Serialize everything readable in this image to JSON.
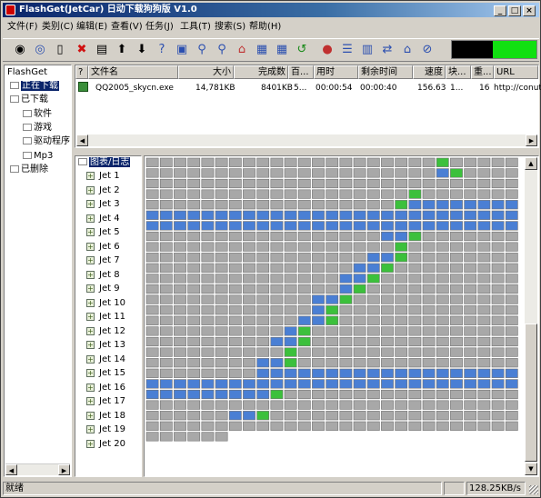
{
  "window": {
    "title": "FlashGet(JetCar) 日动下载狗狗版 V1.0"
  },
  "menu": [
    "文件(F)",
    "类别(C)",
    "编辑(E)",
    "查看(V)",
    "任务(J)",
    "工具(T)",
    "搜索(S)",
    "帮助(H)"
  ],
  "tree": {
    "root": "FlashGet",
    "downloading": "正在下载",
    "downloaded": "已下载",
    "categories": [
      "软件",
      "游戏",
      "驱动程序",
      "Mp3"
    ],
    "deleted": "已删除"
  },
  "list": {
    "columns": [
      "文件名",
      "大小",
      "完成数",
      "百...",
      "用时",
      "剩余时间",
      "速度",
      "块...",
      "重...",
      "URL"
    ],
    "rows": [
      {
        "name": "QQ2005_skycn.exe",
        "size": "14,781KB",
        "done": "8401KB",
        "percent": "5...",
        "elapsed": "00:00:54",
        "remaining": "00:00:40",
        "speed": "156.63",
        "blocks": "1...",
        "retries": "16",
        "url": "http://conut.s"
      }
    ]
  },
  "jets": {
    "header": "图表/日志",
    "items": [
      "Jet 1",
      "Jet 2",
      "Jet 3",
      "Jet 4",
      "Jet 5",
      "Jet 6",
      "Jet 7",
      "Jet 8",
      "Jet 9",
      "Jet 10",
      "Jet 11",
      "Jet 12",
      "Jet 13",
      "Jet 14",
      "Jet 15",
      "Jet 16",
      "Jet 17",
      "Jet 18",
      "Jet 19",
      "Jet 20"
    ]
  },
  "blockmap": {
    "colors": {
      "pending": "#a8a8a8",
      "done": "#4a7fd4",
      "active": "#3cc03c",
      "empty": "#ffffff"
    },
    "cols": 27,
    "rows": [
      {
        "done": [],
        "active": [
          21
        ]
      },
      {
        "done": [
          21
        ],
        "active": [
          22
        ]
      },
      {
        "done": [],
        "active": []
      },
      {
        "done": [],
        "active": [
          19
        ]
      },
      {
        "done": [
          19,
          20,
          21,
          22,
          23,
          24,
          25,
          26
        ],
        "active": [
          18
        ]
      },
      {
        "done": [
          0,
          1,
          2,
          3,
          4,
          5,
          6,
          7,
          8,
          9,
          10,
          11,
          12,
          13,
          14,
          15,
          16,
          17,
          18,
          19,
          20,
          21,
          22,
          23,
          24,
          25,
          26
        ],
        "active": []
      },
      {
        "done": [
          0,
          1,
          2,
          3,
          4,
          5,
          6,
          7,
          8,
          9,
          10,
          11,
          12,
          13,
          14,
          15,
          16,
          17,
          18,
          19,
          20,
          21,
          22,
          23,
          24,
          25,
          26
        ],
        "active": []
      },
      {
        "done": [
          17,
          18
        ],
        "active": [
          19
        ]
      },
      {
        "done": [],
        "active": [
          18
        ]
      },
      {
        "done": [
          16,
          17
        ],
        "active": [
          18
        ]
      },
      {
        "done": [
          15,
          16
        ],
        "active": [
          17
        ]
      },
      {
        "done": [
          14,
          15
        ],
        "active": [
          16
        ]
      },
      {
        "done": [
          14
        ],
        "active": [
          15
        ]
      },
      {
        "done": [
          12,
          13
        ],
        "active": [
          14
        ]
      },
      {
        "done": [
          12
        ],
        "active": [
          13
        ]
      },
      {
        "done": [
          11,
          12
        ],
        "active": [
          13
        ]
      },
      {
        "done": [
          10
        ],
        "active": [
          11
        ]
      },
      {
        "done": [
          9,
          10
        ],
        "active": [
          11
        ]
      },
      {
        "done": [],
        "active": [
          10
        ]
      },
      {
        "done": [
          8,
          9
        ],
        "active": [
          10
        ]
      },
      {
        "done": [
          8,
          9,
          10,
          11,
          12,
          13,
          14,
          15,
          16,
          17,
          18,
          19,
          20,
          21,
          22,
          23,
          24,
          25,
          26
        ],
        "active": []
      },
      {
        "done": [
          0,
          1,
          2,
          3,
          4,
          5,
          6,
          7,
          8,
          9,
          10,
          11,
          12,
          13,
          14,
          15,
          16,
          17,
          18,
          19,
          20,
          21,
          22,
          23,
          24,
          25,
          26
        ],
        "active": []
      },
      {
        "done": [
          0,
          1,
          2,
          3,
          4,
          5,
          6,
          7,
          8
        ],
        "active": [
          9
        ]
      },
      {
        "done": [],
        "active": []
      },
      {
        "done": [
          6,
          7
        ],
        "active": [
          8
        ]
      },
      {
        "done": [],
        "active": []
      },
      {
        "done": [],
        "active": [],
        "filled": 6
      }
    ]
  },
  "status": {
    "text": "就绪",
    "speed": "128.25KB/s"
  }
}
